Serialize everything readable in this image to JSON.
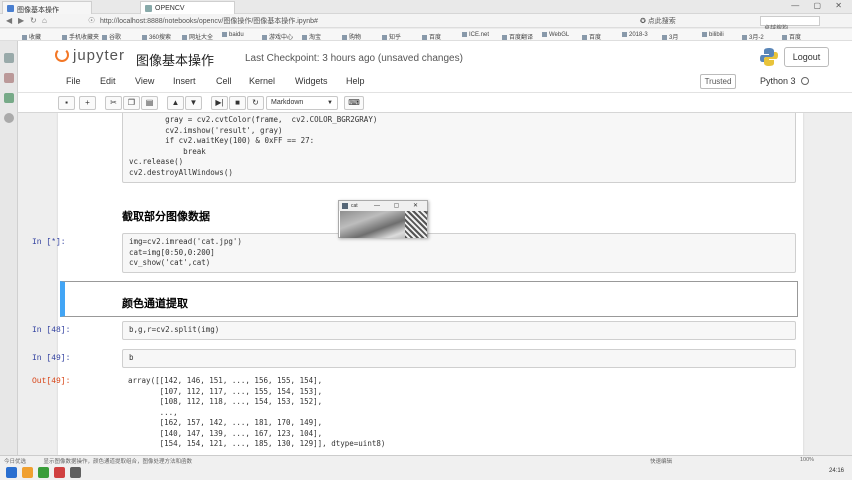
{
  "browser": {
    "tabs": [
      {
        "label": "图像基本操作"
      },
      {
        "label": "OPENCV"
      }
    ],
    "url": "http://localhost:8888/notebooks/opencv/图像操作/图像基本操作.ipynb#",
    "url_right": "✪ 点此搜索",
    "address_right_text": "卓越搜狗",
    "window_controls": "— ▢ ✕",
    "bookmarks": [
      "收藏",
      "手机收藏夹",
      "谷歌",
      "360搜索",
      "网址大全",
      "baidu",
      "游戏中心",
      "淘宝",
      "购物",
      "知乎",
      "百度",
      "ICE.net",
      "百度翻译",
      "WebGL",
      "百度",
      "2018-3",
      "3月",
      "bilibili",
      "3月-2",
      "百度"
    ]
  },
  "jupyter": {
    "logo_text": "jupyter",
    "notebook_title": "图像基本操作",
    "checkpoint": "Last Checkpoint: 3 hours ago (unsaved changes)",
    "logout_label": "Logout",
    "menu": [
      "File",
      "Edit",
      "View",
      "Insert",
      "Cell",
      "Kernel",
      "Widgets",
      "Help"
    ],
    "trusted_label": "Trusted",
    "kernel_name": "Python 3",
    "cell_type": "Markdown"
  },
  "cells": {
    "code1": {
      "lines": [
        "        gray = cv2.cvtColor(frame,  cv2.COLOR_BGR2GRAY)",
        "        cv2.imshow('result', gray)",
        "        if cv2.waitKey(100) & 0xFF == 27:",
        "            break",
        "vc.release()",
        "cv2.destroyAllWindows()"
      ]
    },
    "md1": {
      "text": "截取部分图像数据"
    },
    "code2": {
      "prompt": "In [*]:",
      "lines": [
        "img=cv2.imread('cat.jpg')",
        "cat=img[0:50,0:200]",
        "cv_show('cat',cat)"
      ]
    },
    "md2": {
      "text": "颜色通道提取"
    },
    "code3": {
      "prompt": "In [48]:",
      "lines": [
        "b,g,r=cv2.split(img)"
      ]
    },
    "code4": {
      "prompt": "In [49]:",
      "lines": [
        "b"
      ]
    },
    "out4": {
      "prompt": "Out[49]:",
      "lines": [
        "array([[142, 146, 151, ..., 156, 155, 154],",
        "       [107, 112, 117, ..., 155, 154, 153],",
        "       [108, 112, 118, ..., 154, 153, 152],",
        "       ...,",
        "       [162, 157, 142, ..., 181, 170, 149],",
        "       [140, 147, 139, ..., 167, 123, 104],",
        "       [154, 154, 121, ..., 185, 130, 129]], dtype=uint8)"
      ]
    }
  },
  "cat_window": {
    "title": "cat",
    "controls": "— ▢ ✕"
  },
  "taskbar": {
    "status_left": "今日优选",
    "status_msg": "显示图像数据操作，颜色通道提取组合，图像处理方法和函数",
    "status_right": "快速编辑",
    "zoom": "100%",
    "clock": "24:16"
  },
  "colors": {
    "jupyter_orange": "#f37726",
    "prompt_in": "#303f9f",
    "prompt_out": "#d84315",
    "selected_cell_bar": "#42a5f5"
  }
}
